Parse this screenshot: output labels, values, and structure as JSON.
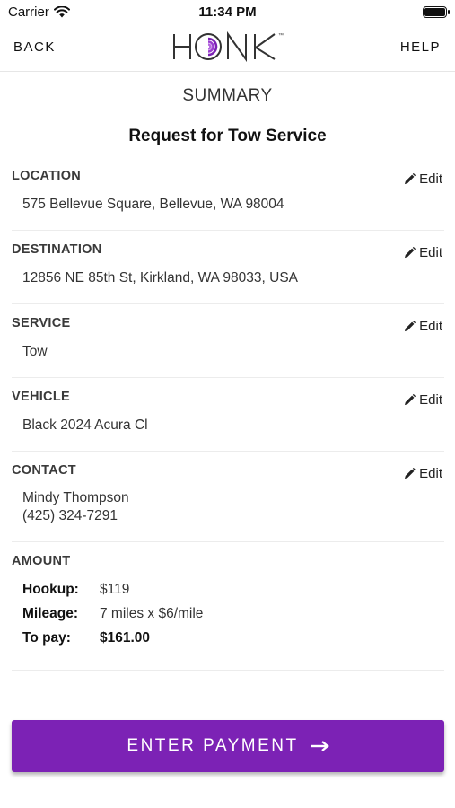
{
  "status_bar": {
    "carrier": "Carrier",
    "time": "11:34 PM"
  },
  "nav": {
    "back_label": "BACK",
    "help_label": "HELP",
    "logo_text": "HONK",
    "logo_mark": "™"
  },
  "summary": {
    "heading": "SUMMARY",
    "title": "Request for Tow Service",
    "edit_label": "Edit",
    "location": {
      "label": "LOCATION",
      "value": "575 Bellevue Square, Bellevue, WA 98004"
    },
    "destination": {
      "label": "DESTINATION",
      "value": "12856 NE 85th St, Kirkland, WA 98033, USA"
    },
    "service": {
      "label": "SERVICE",
      "value": "Tow"
    },
    "vehicle": {
      "label": "VEHICLE",
      "value": "Black 2024 Acura Cl"
    },
    "contact": {
      "label": "CONTACT",
      "name": "Mindy Thompson",
      "phone": "(425) 324-7291"
    },
    "amount": {
      "label": "AMOUNT",
      "rows": [
        {
          "key": "Hookup:",
          "value": "$119"
        },
        {
          "key": "Mileage:",
          "value": "7 miles x $6/mile"
        },
        {
          "key": "To pay:",
          "value": "$161.00"
        }
      ]
    }
  },
  "button": {
    "label": "ENTER PAYMENT",
    "color": "#7c22b5"
  },
  "colors": {
    "brand_purple": "#7c22b5"
  }
}
